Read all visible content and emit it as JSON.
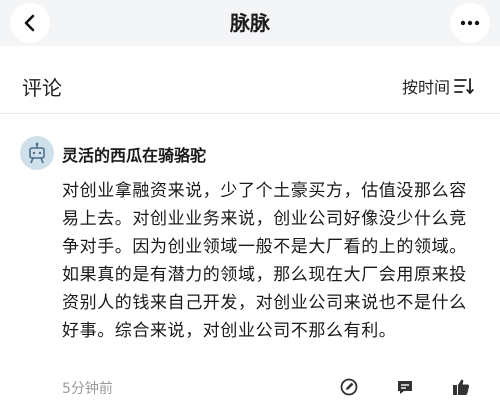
{
  "nav": {
    "title": "脉脉",
    "back_icon": "back-arrow-icon",
    "more_icon": "more-horizontal-icon"
  },
  "comments_header": {
    "title": "评论",
    "sort_label": "按时间",
    "sort_icon": "sort-icon"
  },
  "comment": {
    "author": "灵活的西瓜在骑骆驼",
    "avatar_icon": "avatar-icon",
    "text": "对创业拿融资来说，少了个土豪买方，估值没那么容易上去。对创业业务来说，创业公司好像没少什么竞争对手。因为创业领域一般不是大厂看的上的领域。如果真的是有潜力的领域，那么现在大厂会用原来投资别人的钱来自己开发，对创业公司来说也不是什么好事。综合来说，对创业公司不那么有利。",
    "time": "5分钟前",
    "actions": {
      "edit_icon": "edit-icon",
      "reply_icon": "reply-icon",
      "like_icon": "thumbs-up-icon"
    }
  },
  "colors": {
    "nav_background": "#f4f5f7",
    "avatar_background": "#cfe0ea",
    "muted_text": "#9a9a9a"
  }
}
